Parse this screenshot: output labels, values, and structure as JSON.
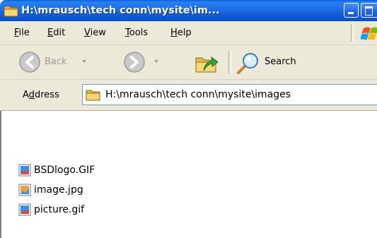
{
  "window": {
    "title": "H:\\mrausch\\tech conn\\mysite\\im..."
  },
  "menu": [
    {
      "accel": "F",
      "rest": "ile"
    },
    {
      "accel": "E",
      "rest": "dit"
    },
    {
      "accel": "V",
      "rest": "iew"
    },
    {
      "accel": "T",
      "rest": "ools"
    },
    {
      "accel": "H",
      "rest": "elp"
    }
  ],
  "toolbar": {
    "back_label": "Back",
    "search_label": "Search"
  },
  "address": {
    "label_pre": "A",
    "label_accel": "d",
    "label_post": "dress",
    "value": "H:\\mrausch\\tech conn\\mysite\\images"
  },
  "files": [
    {
      "name": "BSDlogo.GIF",
      "icon": "gif-file-icon"
    },
    {
      "name": "image.jpg",
      "icon": "jpg-file-icon"
    },
    {
      "name": "picture.gif",
      "icon": "gif-file-icon"
    }
  ],
  "colors": {
    "titlebar": "#0f58d1",
    "chrome": "#ece9d8",
    "address_border": "#7f9db9"
  }
}
